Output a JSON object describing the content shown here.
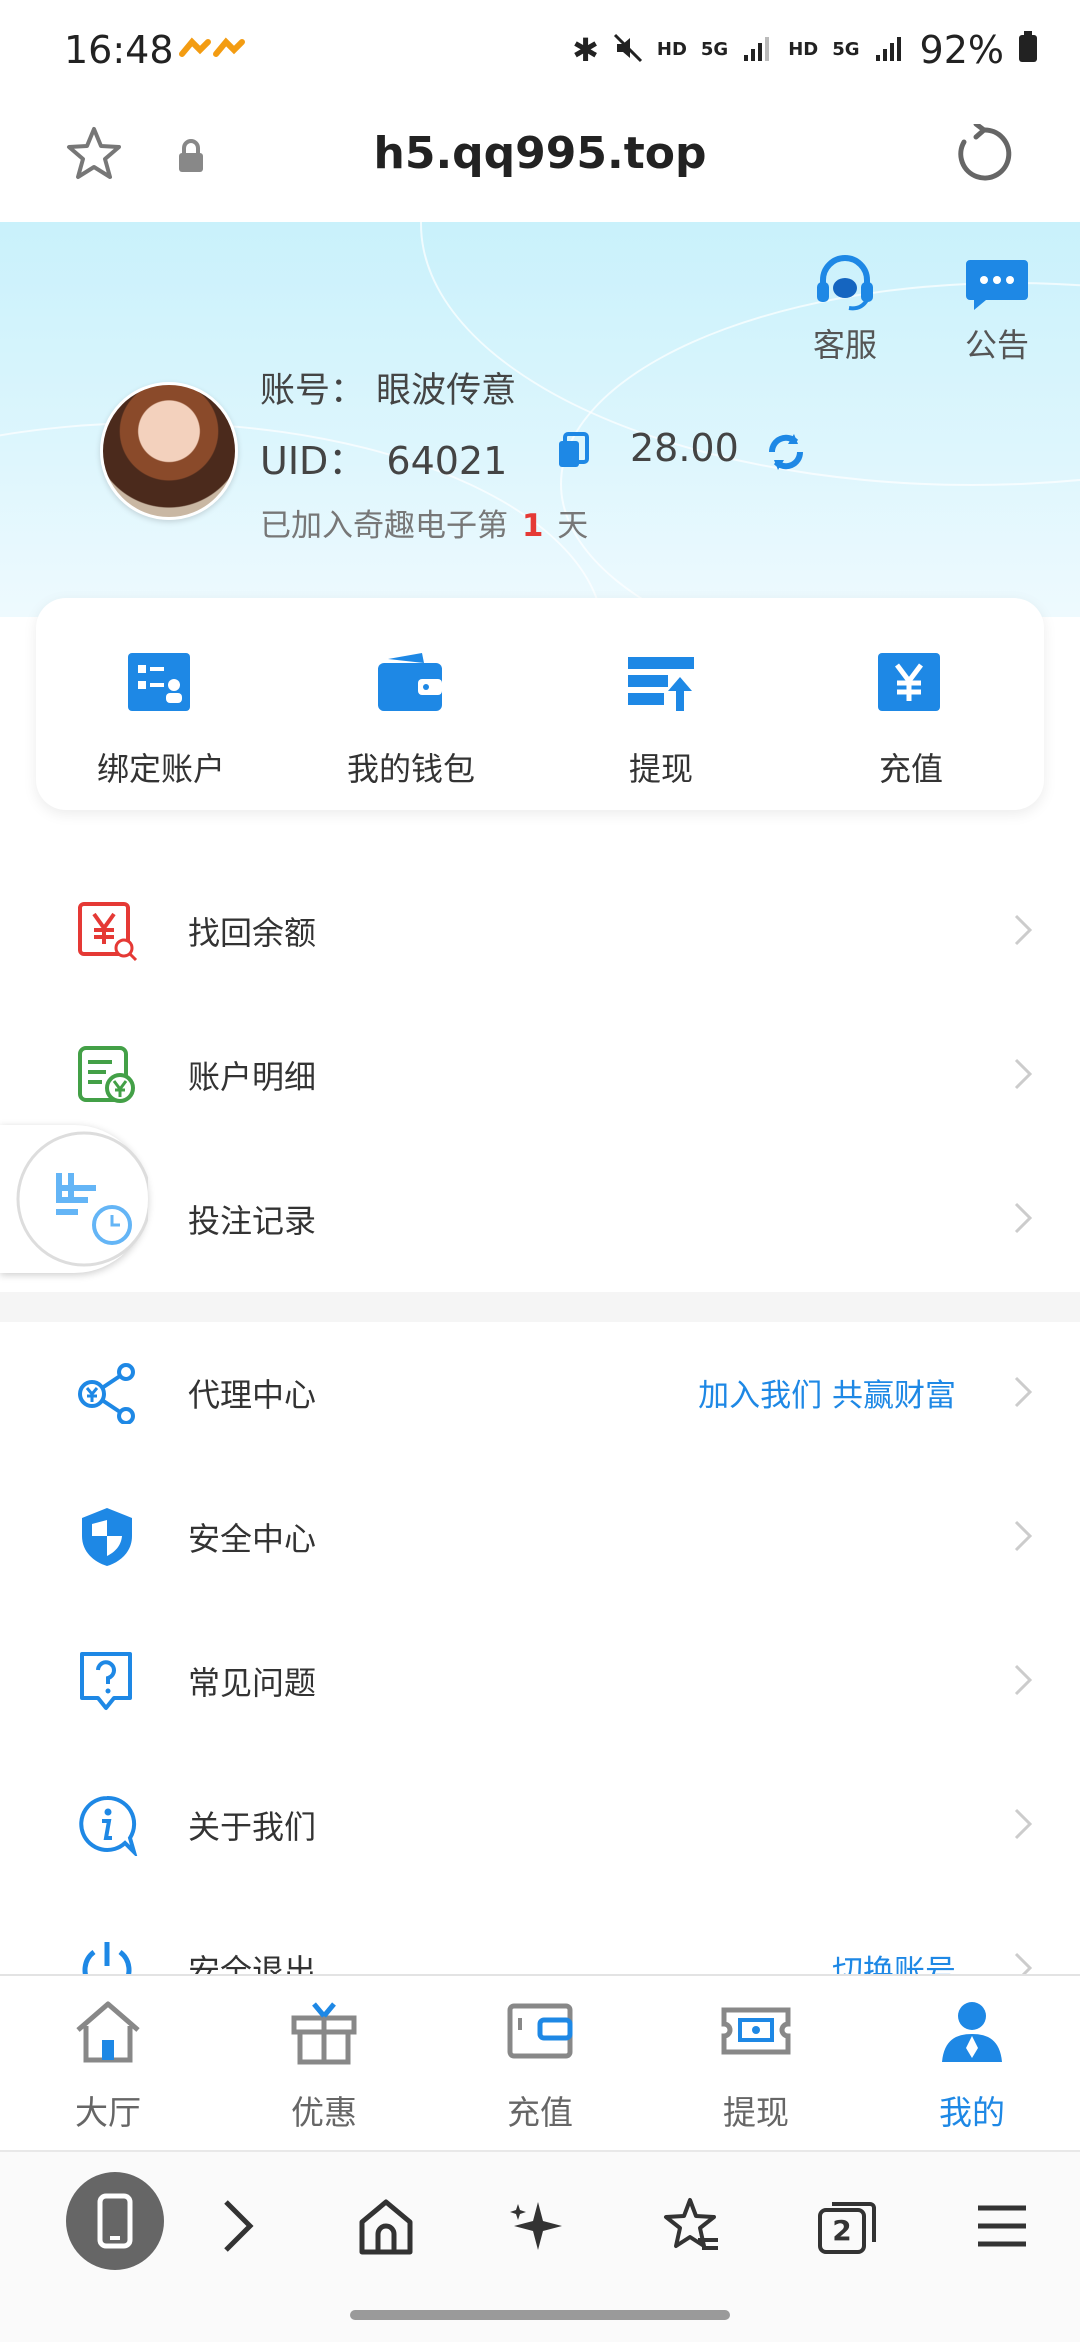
{
  "status_bar": {
    "time": "16:48",
    "hd1": "HD",
    "net1": "5G",
    "hd2": "HD",
    "net2": "5G",
    "battery": "92%"
  },
  "browser_url": {
    "url": "h5.qq995.top"
  },
  "header": {
    "service_label": "客服",
    "notice_label": "公告",
    "account_prefix": "账号：",
    "account_name": "眼波传意",
    "uid_prefix": "UID：",
    "uid": "64021",
    "balance": "28.00",
    "joined_prefix": "已加入奇趣电子第",
    "joined_days": "1",
    "joined_suffix": "天"
  },
  "quick_actions": [
    {
      "label": "绑定账户",
      "icon": "bind-account-icon"
    },
    {
      "label": "我的钱包",
      "icon": "wallet-icon"
    },
    {
      "label": "提现",
      "icon": "withdraw-icon"
    },
    {
      "label": "充值",
      "icon": "recharge-yen-icon"
    }
  ],
  "menu": [
    {
      "label": "找回余额",
      "icon": "recover-balance-icon",
      "extra": ""
    },
    {
      "label": "账户明细",
      "icon": "account-details-icon",
      "extra": ""
    },
    {
      "label": "投注记录",
      "icon": "bet-record-icon",
      "extra": ""
    },
    {
      "label": "代理中心",
      "icon": "agent-center-icon",
      "extra": "加入我们 共赢财富"
    },
    {
      "label": "安全中心",
      "icon": "shield-icon",
      "extra": ""
    },
    {
      "label": "常见问题",
      "icon": "question-icon",
      "extra": ""
    },
    {
      "label": "关于我们",
      "icon": "info-icon",
      "extra": ""
    },
    {
      "label": "安全退出",
      "icon": "power-icon",
      "extra": "切换账号"
    }
  ],
  "tabbar": [
    {
      "label": "大厅",
      "icon": "home-icon",
      "active": false
    },
    {
      "label": "优惠",
      "icon": "gift-icon",
      "active": false
    },
    {
      "label": "充值",
      "icon": "wallet-card-icon",
      "active": false
    },
    {
      "label": "提现",
      "icon": "cash-ticket-icon",
      "active": false
    },
    {
      "label": "我的",
      "icon": "user-icon",
      "active": true
    }
  ],
  "browser_nav": {
    "tab_count": "2"
  },
  "colors": {
    "accent": "#1e88e5",
    "active_tab": "#1e88e5",
    "days_highlight": "#e53935"
  }
}
